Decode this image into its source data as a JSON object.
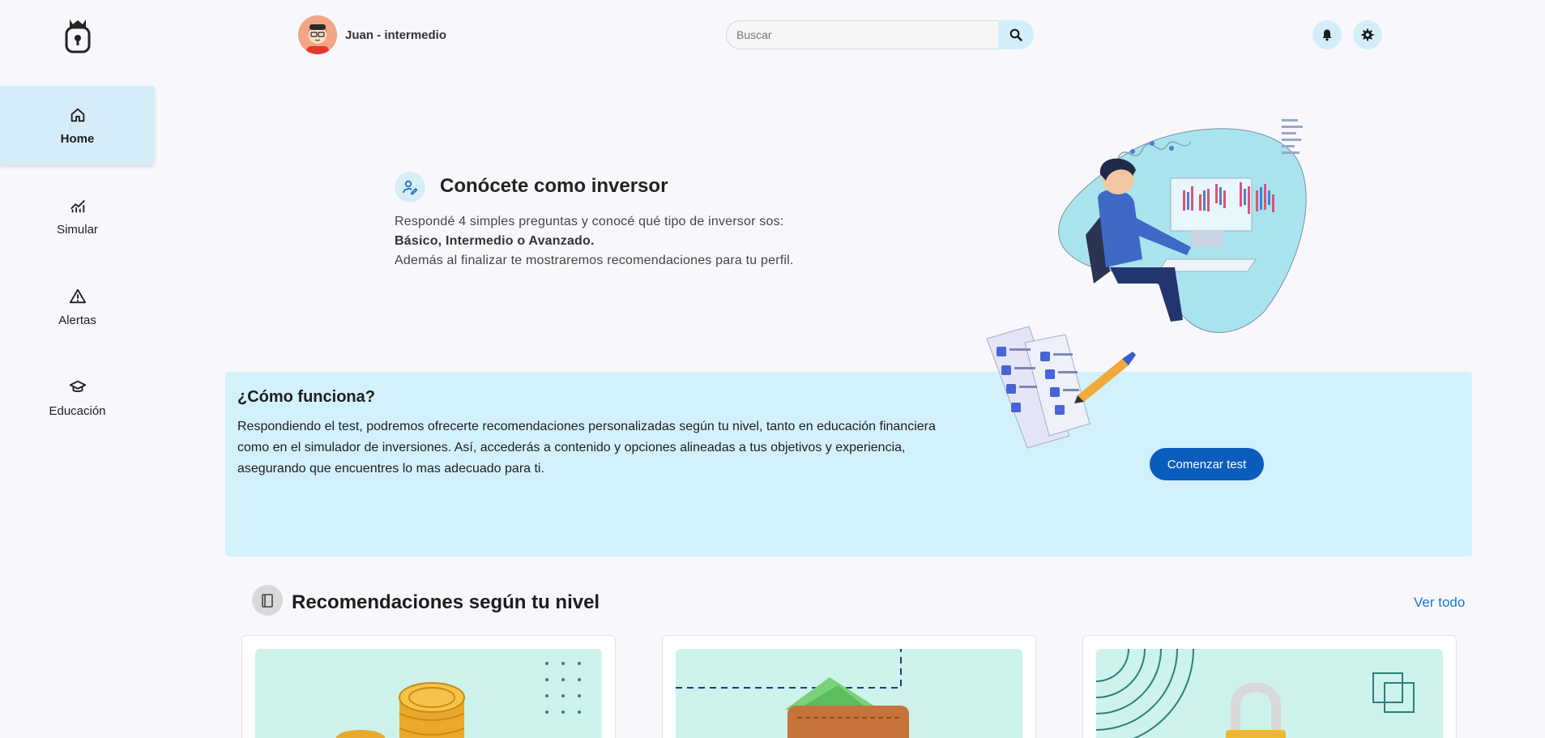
{
  "sidebar": {
    "logo": "money-bag-logo",
    "items": [
      {
        "label": "Home",
        "icon": "home-icon",
        "active": true
      },
      {
        "label": "Simular",
        "icon": "chart-icon",
        "active": false
      },
      {
        "label": "Alertas",
        "icon": "warning-icon",
        "active": false
      },
      {
        "label": "Educación",
        "icon": "graduation-cap-icon",
        "active": false
      }
    ]
  },
  "header": {
    "username": "Juan - intermedio",
    "search_placeholder": "Buscar"
  },
  "hero": {
    "title": "Conócete como inversor",
    "line1": "Respondé 4 simples preguntas y conocé qué tipo de inversor sos:",
    "line2": "Básico, Intermedio o Avanzado.",
    "line3": "Además al finalizar te mostraremos recomendaciones para tu perfil."
  },
  "how": {
    "title": "¿Cómo funciona?",
    "text": "Respondiendo el test, podremos ofrecerte recomendaciones personalizadas según tu nivel, tanto en educación financiera como en el simulador de inversiones. Así, accederás a contenido y opciones alineadas a tus objetivos y experiencia, asegurando que encuentres lo mas adecuado para ti.",
    "button": "Comenzar test"
  },
  "recommendations": {
    "title": "Recomendaciones según tu nivel",
    "see_all": "Ver todo",
    "cards": [
      {
        "image": "coins-illustration"
      },
      {
        "image": "wallet-illustration"
      },
      {
        "image": "padlock-illustration"
      }
    ]
  },
  "colors": {
    "accent": "#0b5dbd",
    "active_nav": "#d6ecf8",
    "info_panel": "#d3f1fb",
    "link": "#1976d2"
  }
}
